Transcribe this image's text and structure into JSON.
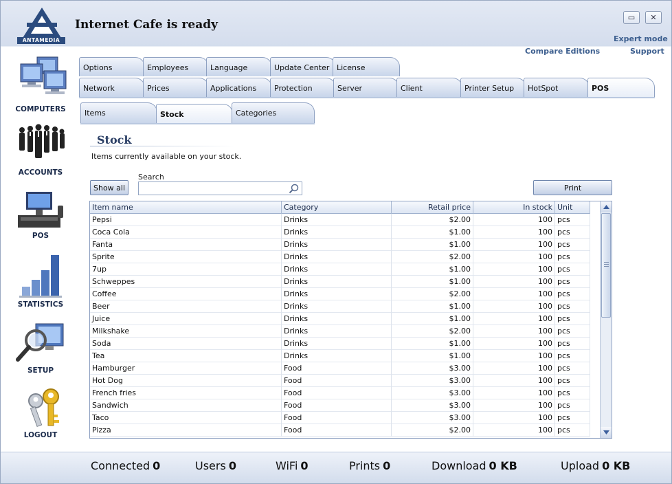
{
  "app": {
    "title": "Internet Cafe is ready",
    "logo_text": "ANTAMEDIA",
    "minimize_glyph": "▭",
    "close_glyph": "✕"
  },
  "top_links": {
    "expert_mode": "Expert mode",
    "compare_editions": "Compare Editions",
    "support": "Support"
  },
  "sidebar": {
    "items": [
      {
        "label": "COMPUTERS",
        "icon": "computers-icon"
      },
      {
        "label": "ACCOUNTS",
        "icon": "accounts-icon"
      },
      {
        "label": "POS",
        "icon": "pos-icon"
      },
      {
        "label": "STATISTICS",
        "icon": "statistics-icon"
      },
      {
        "label": "SETUP",
        "icon": "setup-icon"
      },
      {
        "label": "LOGOUT",
        "icon": "logout-icon"
      }
    ]
  },
  "tabs": {
    "row1": [
      "Options",
      "Employees",
      "Language",
      "Update Center",
      "License"
    ],
    "row2": [
      "Network",
      "Prices",
      "Applications",
      "Protection",
      "Server",
      "Client",
      "Printer Setup",
      "HotSpot",
      "POS"
    ],
    "row2_active": "POS",
    "sub": [
      "Items",
      "Stock",
      "Categories"
    ],
    "sub_active": "Stock"
  },
  "stock": {
    "title": "Stock",
    "description": "Items currently available on your stock.",
    "show_all_label": "Show all",
    "search_label": "Search",
    "search_value": "",
    "print_label": "Print",
    "columns": [
      "Item name",
      "Category",
      "Retail price",
      "In stock",
      "Unit"
    ],
    "rows": [
      [
        "Pepsi",
        "Drinks",
        "$2.00",
        "100",
        "pcs"
      ],
      [
        "Coca Cola",
        "Drinks",
        "$1.00",
        "100",
        "pcs"
      ],
      [
        "Fanta",
        "Drinks",
        "$1.00",
        "100",
        "pcs"
      ],
      [
        "Sprite",
        "Drinks",
        "$2.00",
        "100",
        "pcs"
      ],
      [
        "7up",
        "Drinks",
        "$1.00",
        "100",
        "pcs"
      ],
      [
        "Schweppes",
        "Drinks",
        "$1.00",
        "100",
        "pcs"
      ],
      [
        "Coffee",
        "Drinks",
        "$2.00",
        "100",
        "pcs"
      ],
      [
        "Beer",
        "Drinks",
        "$1.00",
        "100",
        "pcs"
      ],
      [
        "Juice",
        "Drinks",
        "$1.00",
        "100",
        "pcs"
      ],
      [
        "Milkshake",
        "Drinks",
        "$2.00",
        "100",
        "pcs"
      ],
      [
        "Soda",
        "Drinks",
        "$1.00",
        "100",
        "pcs"
      ],
      [
        "Tea",
        "Drinks",
        "$1.00",
        "100",
        "pcs"
      ],
      [
        "Hamburger",
        "Food",
        "$3.00",
        "100",
        "pcs"
      ],
      [
        "Hot Dog",
        "Food",
        "$3.00",
        "100",
        "pcs"
      ],
      [
        "French fries",
        "Food",
        "$3.00",
        "100",
        "pcs"
      ],
      [
        "Sandwich",
        "Food",
        "$3.00",
        "100",
        "pcs"
      ],
      [
        "Taco",
        "Food",
        "$3.00",
        "100",
        "pcs"
      ],
      [
        "Pizza",
        "Food",
        "$2.00",
        "100",
        "pcs"
      ]
    ]
  },
  "status": {
    "connected_label": "Connected",
    "connected_value": "0",
    "users_label": "Users",
    "users_value": "0",
    "wifi_label": "WiFi",
    "wifi_value": "0",
    "prints_label": "Prints",
    "prints_value": "0",
    "download_label": "Download",
    "download_value": "0 KB",
    "upload_label": "Upload",
    "upload_value": "0 KB"
  },
  "colors": {
    "accent": "#3d5f8f",
    "tab_gradient_top": "#f2f5fb",
    "tab_gradient_bottom": "#c8d5ea",
    "scrollbar": "#e9eef6"
  }
}
